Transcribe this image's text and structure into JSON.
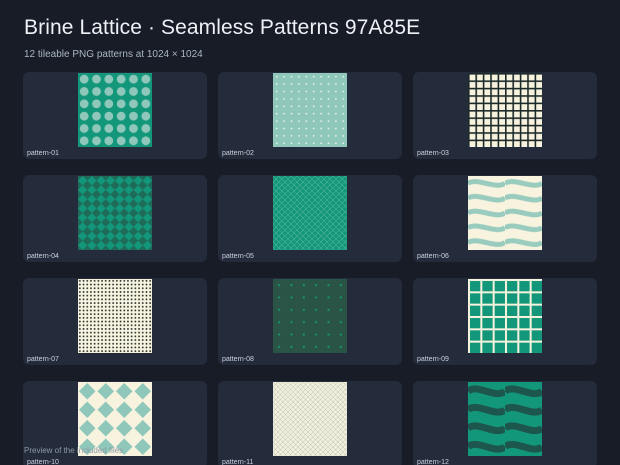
{
  "header": {
    "title": "Brine Lattice · Seamless Patterns 97A85E",
    "subtitle": "12 tileable PNG patterns at 1024 × 1024"
  },
  "patterns": [
    {
      "label": "pattern-01"
    },
    {
      "label": "pattern-02"
    },
    {
      "label": "pattern-03"
    },
    {
      "label": "pattern-04"
    },
    {
      "label": "pattern-05"
    },
    {
      "label": "pattern-06"
    },
    {
      "label": "pattern-07"
    },
    {
      "label": "pattern-08"
    },
    {
      "label": "pattern-09"
    },
    {
      "label": "pattern-10"
    },
    {
      "label": "pattern-11"
    },
    {
      "label": "pattern-12"
    }
  ],
  "footer": {
    "note": "Preview of the included files"
  },
  "colors": {
    "background": "#171c27",
    "card": "#242b3b",
    "teal": "#13977a",
    "mint": "#8fc7bb",
    "cream": "#f7f3de",
    "dark_green": "#2a5445",
    "ink": "#1d2a2a"
  }
}
